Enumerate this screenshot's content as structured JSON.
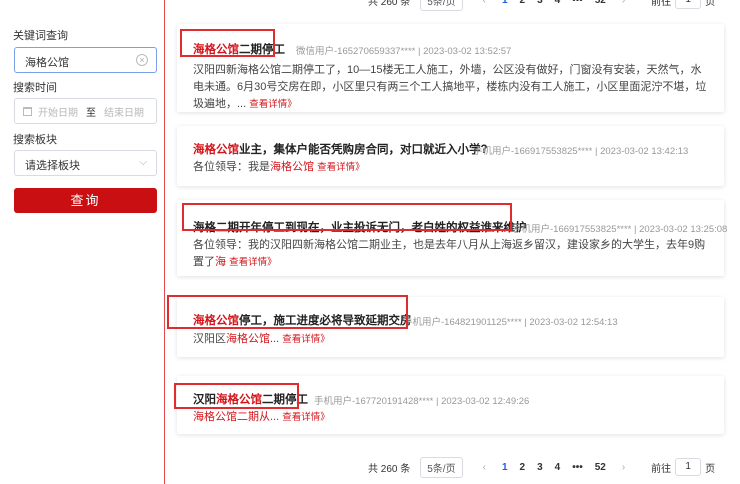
{
  "sidebar": {
    "keyword_label": "关键词查询",
    "keyword_value": "海格公馆",
    "time_label": "搜索时间",
    "start_placeholder": "开始日期",
    "to_text": "至",
    "end_placeholder": "结束日期",
    "board_label": "搜索板块",
    "board_placeholder": "请选择板块",
    "query_button": "查询"
  },
  "pagination": {
    "total": "共 260 条",
    "page_size": "5条/页",
    "pages": [
      "1",
      "2",
      "3",
      "4",
      "•••",
      "52"
    ],
    "goto_label": "前往",
    "goto_value": "1",
    "page_unit": "页"
  },
  "results": [
    {
      "title_pre": "",
      "title_hl": "海格公馆",
      "title_post": "二期停工",
      "meta": "微信用户-165270659337**** | 2023-03-02 13:52:57",
      "body": "汉阳四新海格公馆二期停工了，10—15楼无工人施工，外墙，公区没有做好，门窗没有安装，天然气，水电未通。6月30号交房在即，小区里只有两三个工人搞地平，楼栋内没有工人施工，小区里面泥泞不堪，垃圾遍地，...",
      "more": "查看详情》"
    },
    {
      "title_pre": "",
      "title_hl": "海格公馆",
      "title_post": "业主，集体户能否凭购房合同，对口就近入小学?",
      "meta": "手机用户-166917553825**** | 2023-03-02 13:42:13",
      "body_pre": "各位领导：我是",
      "body_hl": "海格公馆",
      "more": "查看详情》"
    },
    {
      "title": "海格二期开年停工到现在，业主投诉无门，老白姓的权益谁来维护",
      "meta": "手机用户-166917553825**** | 2023-03-02 13:25:08",
      "body": "各位领导：我的汉阳四新海格公馆二期业主，也是去年八月从上海返乡留汉，建设家乡的大学生，去年9购置了",
      "body_hl": "海",
      "more": "查看详情》"
    },
    {
      "title_hl": "海格公馆",
      "title_post": "停工，施工进度必将导致延期交房",
      "meta": "手机用户-164821901125**** | 2023-03-02 12:54:13",
      "body_pre": "汉阳区",
      "body_hl": "海格公馆",
      "body_post": "...",
      "more": "查看详情》"
    },
    {
      "title_pre": "汉阳",
      "title_hl": "海格公馆",
      "title_post": "二期停工",
      "meta": "手机用户-167720191428**** | 2023-03-02 12:49:26",
      "body_hl": "海格公馆",
      "body_post": "二期从...",
      "more": "查看详情》"
    }
  ],
  "colors": {
    "brand_red": "#c90f12",
    "highlight": "#d4151b",
    "link_blue": "#1a5fd6"
  }
}
